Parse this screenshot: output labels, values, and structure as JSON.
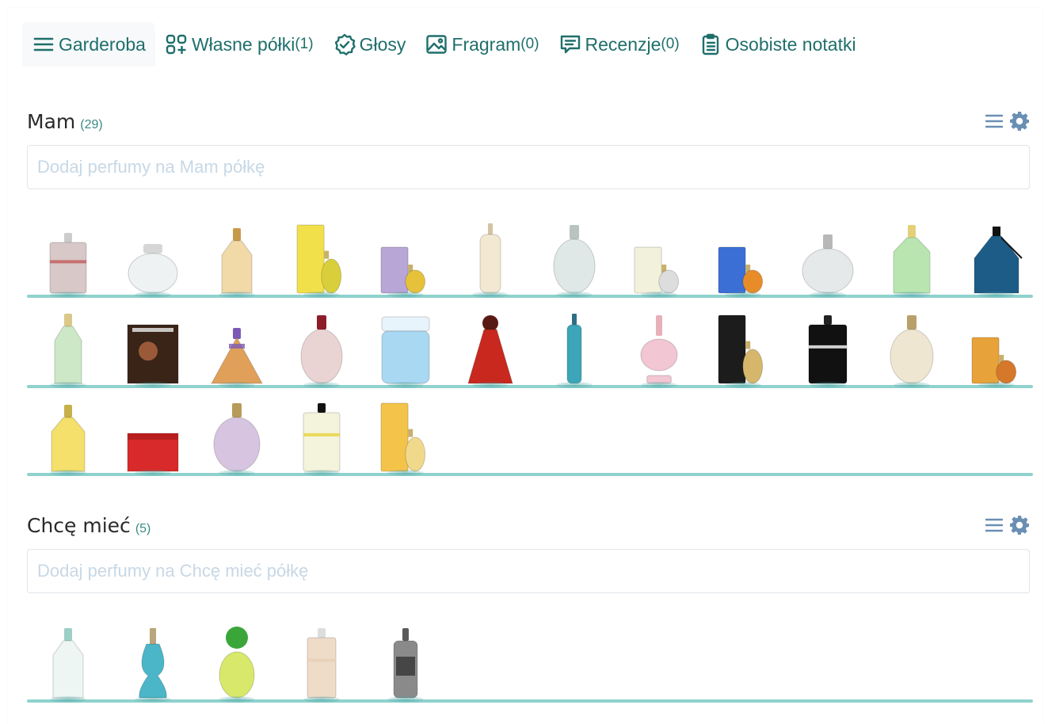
{
  "nav": {
    "items": [
      {
        "label": "Garderoba",
        "count": "",
        "icon": "menu-icon"
      },
      {
        "label": "Własne półki",
        "count": "(1)",
        "icon": "custom-shelves-icon"
      },
      {
        "label": "Głosy",
        "count": "",
        "icon": "check-circle-icon"
      },
      {
        "label": "Fragram",
        "count": "(0)",
        "icon": "image-icon"
      },
      {
        "label": "Recenzje",
        "count": "(0)",
        "icon": "review-icon"
      },
      {
        "label": "Osobiste notatki",
        "count": "",
        "icon": "clipboard-icon"
      }
    ],
    "active": 0,
    "color": "#1f6f6b"
  },
  "shelves": [
    {
      "title": "Mam",
      "count": "(29)",
      "placeholder": "Dodaj perfumy na Mam półkę",
      "bottles": [
        "burberry-brit",
        "oval-white-cap",
        "guerlain-aqua-allegoria",
        "tall-yellow-box-bottle",
        "purple-box-bottle",
        "slim-tall-bottle",
        "67-round-bottle",
        "white-box-bottle",
        "blue-box-orange-bottle",
        "round-clear-bottle",
        "green-tall-bottle",
        "blue-flask-bottle",
        "green-tall-bottle-2",
        "poster-box",
        "pyramid-bottle",
        "you-bottle",
        "blue-jar-bottle",
        "red-bell-bottle",
        "blue-thin-bottle",
        "pink-bottle",
        "black-box-gold-bottle",
        "black-square-bottle",
        "gold-cap-bottle",
        "charlie-gold-bottle",
        "yellow-4711-bottle",
        "red-box",
        "lilac-round-bottle",
        "flower-clear-bottle",
        "yellow-box-bottle"
      ]
    },
    {
      "title": "Chcę mieć",
      "count": "(5)",
      "placeholder": "Dodaj perfumy na Chcę mieć półkę",
      "bottles": [
        "clear-tall-bottle",
        "blue-curvy-bottle",
        "cabotine-green-bottle",
        "peach-rect-bottle",
        "silver-spray-bottle"
      ]
    }
  ],
  "colors": {
    "accent": "#1f6f6b",
    "shelf_line": "#8fd2cd",
    "count": "#3b8b86",
    "tool_icons": "#6a8fb3"
  }
}
